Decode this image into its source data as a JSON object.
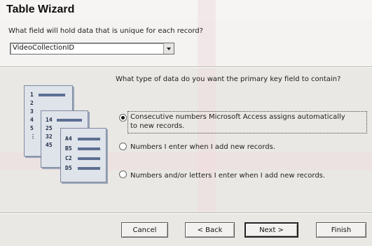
{
  "window": {
    "title": "Table Wizard"
  },
  "unique_field": {
    "question": "What field will hold data that is unique for each record?",
    "selected_value": "VideoCollectionID"
  },
  "primary_key": {
    "question": "What type of data do you want the primary key field to contain?",
    "options": [
      {
        "label_line1": "Consecutive numbers Microsoft Access assigns automatically",
        "label_line2": "to new records.",
        "selected": true
      },
      {
        "label_line1": "Numbers I enter when I add new records.",
        "selected": false
      },
      {
        "label_line1": "Numbers and/or letters I enter when I add new records.",
        "selected": false
      }
    ]
  },
  "illustration": {
    "card1": [
      "1",
      "2",
      "3",
      "4",
      "5",
      "⋮"
    ],
    "card2": [
      "14",
      "25",
      "32",
      "45"
    ],
    "card3": [
      "A4",
      "B5",
      "C2",
      "D5"
    ]
  },
  "buttons": {
    "cancel": "Cancel",
    "back": "< Back",
    "next": "Next >",
    "finish": "Finish"
  },
  "colors": {
    "accent_watermark": "#f1dde0",
    "panel": "#e9e8e5"
  }
}
